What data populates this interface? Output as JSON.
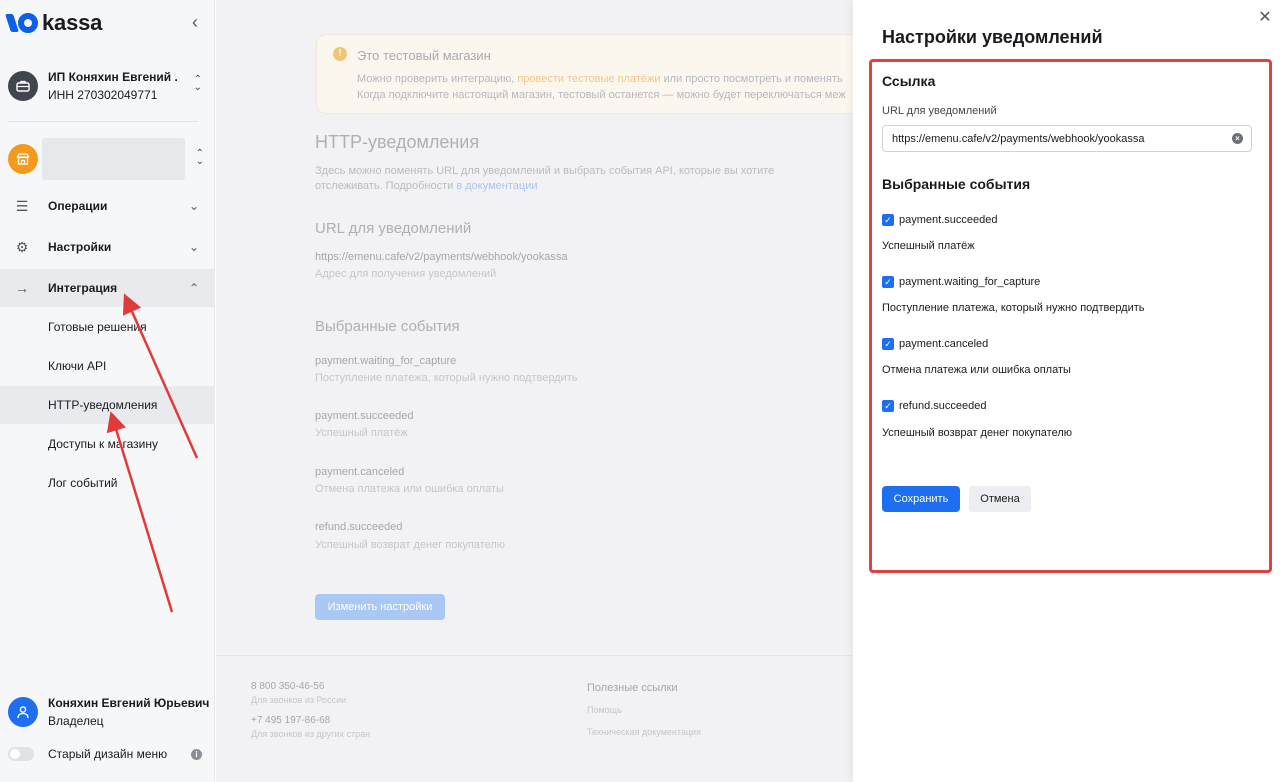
{
  "brand": {
    "name": "kassa",
    "color": "#0c5fe8"
  },
  "sidebar": {
    "company": {
      "name": "ИП Коняхин Евгений ...",
      "inn": "ИНН 270302049771",
      "icon": "briefcase-icon"
    },
    "shop": {
      "icon": "shop-icon"
    },
    "nav": [
      {
        "label": "Операции",
        "icon": "list-icon"
      },
      {
        "label": "Настройки",
        "icon": "gear-icon"
      },
      {
        "label": "Интеграция",
        "icon": "arrow-right-icon"
      }
    ],
    "integration_items": [
      {
        "label": "Готовые решения"
      },
      {
        "label": "Ключи API"
      },
      {
        "label": "HTTP-уведомления"
      },
      {
        "label": "Доступы к магазину"
      },
      {
        "label": "Лог событий"
      }
    ],
    "user": {
      "name": "Коняхин Евгений Юрьевич",
      "role": "Владелец"
    },
    "old_design_label": "Старый дизайн меню"
  },
  "main": {
    "banner": {
      "title": "Это тестовый магазин",
      "line1_before": "Можно проверить интеграцию, ",
      "line1_link": "провести тестовые платёжи",
      "line1_after": " или просто посмотреть и поменять",
      "line2": "Когда подключите настоящий магазин, тестовый останется — можно будет переключаться меж"
    },
    "title": "HTTP-уведомления",
    "description": "Здесь можно поменять URL для уведомлений и выбрать события API, которые вы хотите отслеживать. Подробности ",
    "description_link": "в документации",
    "url_heading": "URL для уведомлений",
    "url_value": "https://emenu.cafe/v2/payments/webhook/yookassa",
    "url_hint": "Адрес для получения уведомлений",
    "events_heading": "Выбранные события",
    "events": [
      {
        "name": "payment.waiting_for_capture",
        "desc": "Поступление платежа, который нужно подтвердить"
      },
      {
        "name": "payment.succeeded",
        "desc": "Успешный платёж"
      },
      {
        "name": "payment.canceled",
        "desc": "Отмена платежа или ошибка оплаты"
      },
      {
        "name": "refund.succeeded",
        "desc": "Успешный возврат денег покупателю"
      }
    ],
    "change_button": "Изменить настройки",
    "footer": {
      "phone1": "8 800 350-46-56",
      "phone1_note": "Для звонков из России",
      "phone2": "+7 495 197-86-68",
      "phone2_note": "Для звонков из других стран",
      "links_heading": "Полезные ссылки",
      "links": [
        "Помощь",
        "Техническая документация"
      ]
    }
  },
  "panel": {
    "title": "Настройки уведомлений",
    "link_section": "Ссылка",
    "url_label": "URL для уведомлений",
    "url_value": "https://emenu.cafe/v2/payments/webhook/yookassa",
    "events_section": "Выбранные события",
    "events": [
      {
        "name": "payment.succeeded",
        "desc": "Успешный платёж",
        "checked": true
      },
      {
        "name": "payment.waiting_for_capture",
        "desc": "Поступление платежа, который нужно подтвердить",
        "checked": true
      },
      {
        "name": "payment.canceled",
        "desc": "Отмена платежа или ошибка оплаты",
        "checked": true
      },
      {
        "name": "refund.succeeded",
        "desc": "Успешный возврат денег покупателю",
        "checked": true
      }
    ],
    "save_label": "Сохранить",
    "cancel_label": "Отмена"
  },
  "colors": {
    "accent": "#1e6ef0",
    "highlight": "#e34040",
    "shop": "#f39a1d"
  }
}
